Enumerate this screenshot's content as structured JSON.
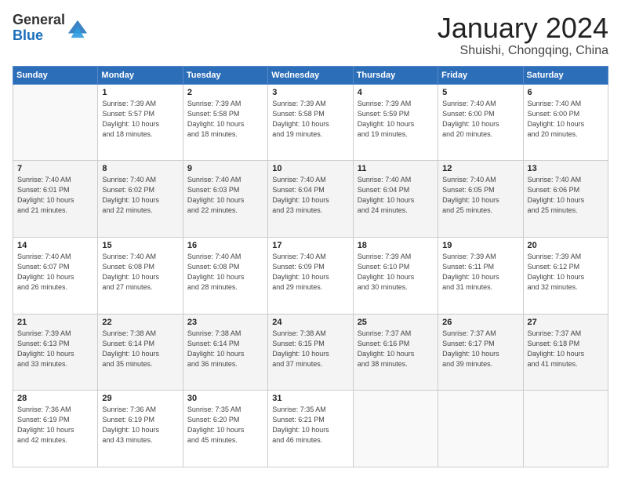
{
  "header": {
    "logo_general": "General",
    "logo_blue": "Blue",
    "month_title": "January 2024",
    "location": "Shuishi, Chongqing, China"
  },
  "days_of_week": [
    "Sunday",
    "Monday",
    "Tuesday",
    "Wednesday",
    "Thursday",
    "Friday",
    "Saturday"
  ],
  "weeks": [
    [
      {
        "day": "",
        "info": ""
      },
      {
        "day": "1",
        "info": "Sunrise: 7:39 AM\nSunset: 5:57 PM\nDaylight: 10 hours\nand 18 minutes."
      },
      {
        "day": "2",
        "info": "Sunrise: 7:39 AM\nSunset: 5:58 PM\nDaylight: 10 hours\nand 18 minutes."
      },
      {
        "day": "3",
        "info": "Sunrise: 7:39 AM\nSunset: 5:58 PM\nDaylight: 10 hours\nand 19 minutes."
      },
      {
        "day": "4",
        "info": "Sunrise: 7:39 AM\nSunset: 5:59 PM\nDaylight: 10 hours\nand 19 minutes."
      },
      {
        "day": "5",
        "info": "Sunrise: 7:40 AM\nSunset: 6:00 PM\nDaylight: 10 hours\nand 20 minutes."
      },
      {
        "day": "6",
        "info": "Sunrise: 7:40 AM\nSunset: 6:00 PM\nDaylight: 10 hours\nand 20 minutes."
      }
    ],
    [
      {
        "day": "7",
        "info": "Sunrise: 7:40 AM\nSunset: 6:01 PM\nDaylight: 10 hours\nand 21 minutes."
      },
      {
        "day": "8",
        "info": "Sunrise: 7:40 AM\nSunset: 6:02 PM\nDaylight: 10 hours\nand 22 minutes."
      },
      {
        "day": "9",
        "info": "Sunrise: 7:40 AM\nSunset: 6:03 PM\nDaylight: 10 hours\nand 22 minutes."
      },
      {
        "day": "10",
        "info": "Sunrise: 7:40 AM\nSunset: 6:04 PM\nDaylight: 10 hours\nand 23 minutes."
      },
      {
        "day": "11",
        "info": "Sunrise: 7:40 AM\nSunset: 6:04 PM\nDaylight: 10 hours\nand 24 minutes."
      },
      {
        "day": "12",
        "info": "Sunrise: 7:40 AM\nSunset: 6:05 PM\nDaylight: 10 hours\nand 25 minutes."
      },
      {
        "day": "13",
        "info": "Sunrise: 7:40 AM\nSunset: 6:06 PM\nDaylight: 10 hours\nand 25 minutes."
      }
    ],
    [
      {
        "day": "14",
        "info": "Sunrise: 7:40 AM\nSunset: 6:07 PM\nDaylight: 10 hours\nand 26 minutes."
      },
      {
        "day": "15",
        "info": "Sunrise: 7:40 AM\nSunset: 6:08 PM\nDaylight: 10 hours\nand 27 minutes."
      },
      {
        "day": "16",
        "info": "Sunrise: 7:40 AM\nSunset: 6:08 PM\nDaylight: 10 hours\nand 28 minutes."
      },
      {
        "day": "17",
        "info": "Sunrise: 7:40 AM\nSunset: 6:09 PM\nDaylight: 10 hours\nand 29 minutes."
      },
      {
        "day": "18",
        "info": "Sunrise: 7:39 AM\nSunset: 6:10 PM\nDaylight: 10 hours\nand 30 minutes."
      },
      {
        "day": "19",
        "info": "Sunrise: 7:39 AM\nSunset: 6:11 PM\nDaylight: 10 hours\nand 31 minutes."
      },
      {
        "day": "20",
        "info": "Sunrise: 7:39 AM\nSunset: 6:12 PM\nDaylight: 10 hours\nand 32 minutes."
      }
    ],
    [
      {
        "day": "21",
        "info": "Sunrise: 7:39 AM\nSunset: 6:13 PM\nDaylight: 10 hours\nand 33 minutes."
      },
      {
        "day": "22",
        "info": "Sunrise: 7:38 AM\nSunset: 6:14 PM\nDaylight: 10 hours\nand 35 minutes."
      },
      {
        "day": "23",
        "info": "Sunrise: 7:38 AM\nSunset: 6:14 PM\nDaylight: 10 hours\nand 36 minutes."
      },
      {
        "day": "24",
        "info": "Sunrise: 7:38 AM\nSunset: 6:15 PM\nDaylight: 10 hours\nand 37 minutes."
      },
      {
        "day": "25",
        "info": "Sunrise: 7:37 AM\nSunset: 6:16 PM\nDaylight: 10 hours\nand 38 minutes."
      },
      {
        "day": "26",
        "info": "Sunrise: 7:37 AM\nSunset: 6:17 PM\nDaylight: 10 hours\nand 39 minutes."
      },
      {
        "day": "27",
        "info": "Sunrise: 7:37 AM\nSunset: 6:18 PM\nDaylight: 10 hours\nand 41 minutes."
      }
    ],
    [
      {
        "day": "28",
        "info": "Sunrise: 7:36 AM\nSunset: 6:19 PM\nDaylight: 10 hours\nand 42 minutes."
      },
      {
        "day": "29",
        "info": "Sunrise: 7:36 AM\nSunset: 6:19 PM\nDaylight: 10 hours\nand 43 minutes."
      },
      {
        "day": "30",
        "info": "Sunrise: 7:35 AM\nSunset: 6:20 PM\nDaylight: 10 hours\nand 45 minutes."
      },
      {
        "day": "31",
        "info": "Sunrise: 7:35 AM\nSunset: 6:21 PM\nDaylight: 10 hours\nand 46 minutes."
      },
      {
        "day": "",
        "info": ""
      },
      {
        "day": "",
        "info": ""
      },
      {
        "day": "",
        "info": ""
      }
    ]
  ]
}
